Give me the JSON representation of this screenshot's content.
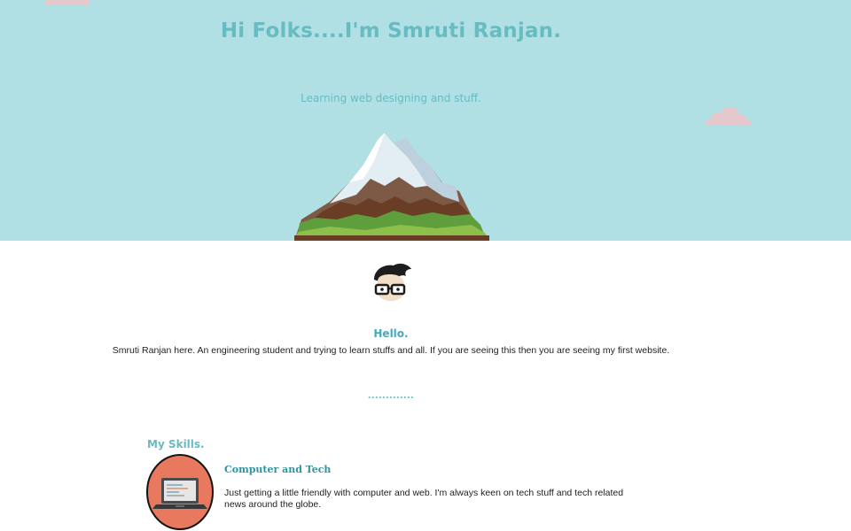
{
  "hero": {
    "title": "Hi Folks....I'm Smruti Ranjan.",
    "subtitle": "Learning web designing and stuff."
  },
  "about": {
    "heading": "Hello.",
    "text": "Smruti Ranjan here. An engineering student and trying to learn stuffs and all. If you are seeing this then you are seeing my first website."
  },
  "divider": {
    "text": "............."
  },
  "skills": {
    "heading": "My Skills.",
    "items": [
      {
        "icon": "laptop-icon",
        "title": "Computer and Tech",
        "description": "Just getting a little friendly with computer and web. I'm always keen on tech stuff and tech related news around the globe."
      }
    ]
  },
  "colors": {
    "hero_bg": "#b0e0e4",
    "accent": "#66bcc0",
    "skill_badge": "#e8795e",
    "cloud": "#e6c8cc"
  },
  "icons": {
    "cloud": "cloud-icon",
    "mountain": "mountain-illustration",
    "avatar": "avatar-icon",
    "laptop": "laptop-icon"
  }
}
